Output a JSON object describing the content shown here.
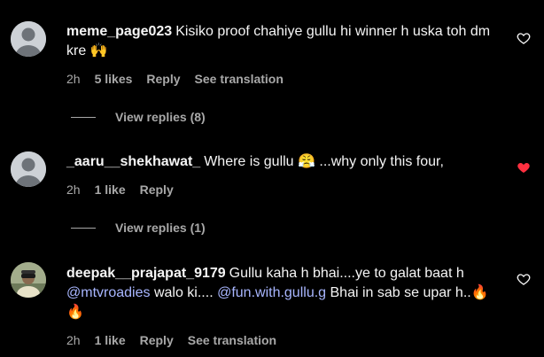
{
  "comments": [
    {
      "username": "meme_page023",
      "text": "Kisiko proof chahiye gullu hi winner h uska toh dm kre 🙌",
      "time": "2h",
      "likes": "5 likes",
      "reply": "Reply",
      "see_translation": "See translation",
      "liked": false,
      "view_replies": "View replies (8)",
      "avatar_icon": "default-avatar-icon"
    },
    {
      "username": "_aaru__shekhawat_",
      "text": "Where is gullu 😤 ...why only this four,",
      "time": "2h",
      "likes": "1 like",
      "reply": "Reply",
      "liked": true,
      "heart_color": "#ff3040",
      "view_replies": "View replies (1)",
      "avatar_icon": "default-avatar-icon"
    },
    {
      "username": "deepak__prajapat_9179",
      "text_before": "Gullu kaha h bhai....ye to galat baat h ",
      "mention1": "@mtvroadies",
      "text_mid": " walo ki.... ",
      "mention2": "@fun.with.gullu.g",
      "text_after": " Bhai in sab se upar h..🔥🔥",
      "time": "2h",
      "likes": "1 like",
      "reply": "Reply",
      "see_translation": "See translation",
      "liked": false,
      "avatar_icon": "profile-photo"
    }
  ],
  "colors": {
    "background": "#000000",
    "text": "#f5f5f5",
    "secondary": "#a8a8a8",
    "mention": "#a8b6ff",
    "like_red": "#ff3040"
  }
}
